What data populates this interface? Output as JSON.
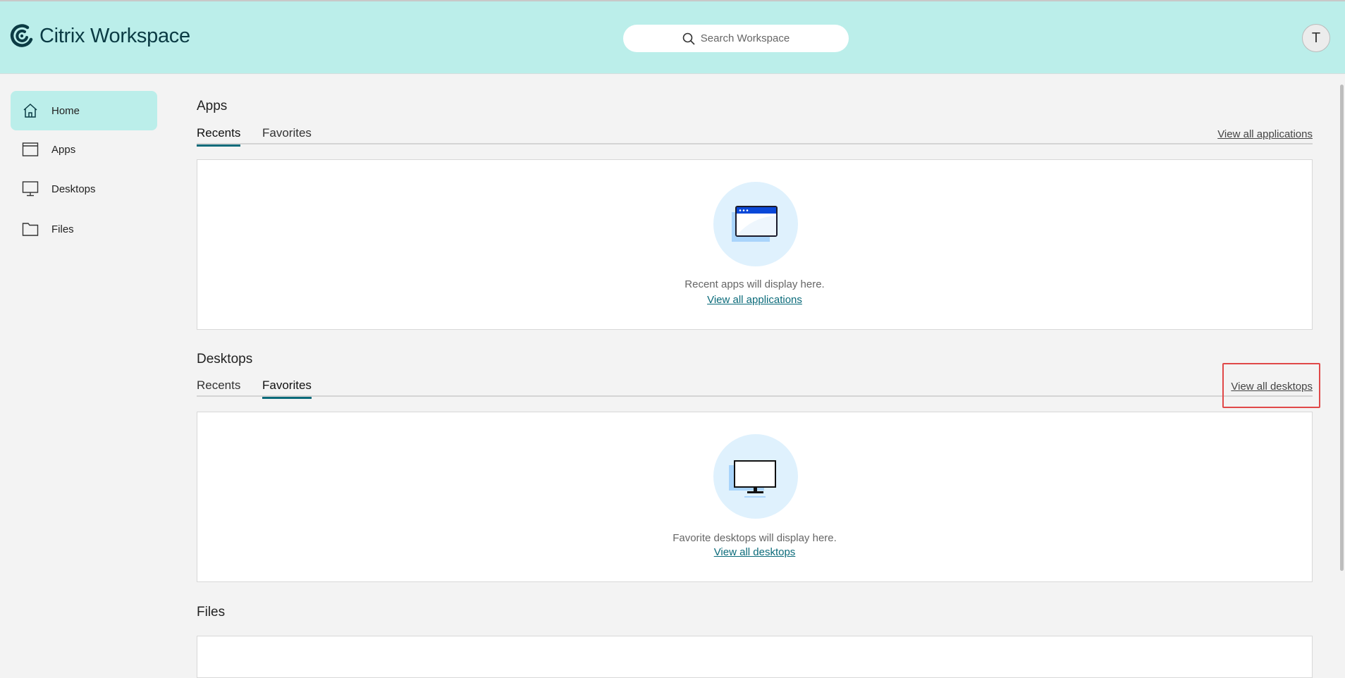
{
  "header": {
    "logo_text": "Citrix Workspace",
    "search_placeholder": "Search Workspace",
    "avatar_initial": "T"
  },
  "sidebar": {
    "items": [
      {
        "label": "Home",
        "icon": "home-icon",
        "active": true
      },
      {
        "label": "Apps",
        "icon": "app-window-icon"
      },
      {
        "label": "Desktops",
        "icon": "monitor-icon"
      },
      {
        "label": "Files",
        "icon": "folder-icon"
      }
    ]
  },
  "apps": {
    "title": "Apps",
    "tabs": [
      "Recents",
      "Favorites"
    ],
    "active_tab": "Recents",
    "view_all": "View all applications",
    "empty_text": "Recent apps will display here.",
    "empty_link": "View all applications"
  },
  "desktops": {
    "title": "Desktops",
    "tabs": [
      "Recents",
      "Favorites"
    ],
    "active_tab": "Favorites",
    "view_all": "View all desktops",
    "empty_text": "Favorite desktops will display here.",
    "empty_link": "View all desktops"
  },
  "files": {
    "title": "Files"
  },
  "colors": {
    "header_bg": "#bbeeea",
    "accent": "#0b6b7a",
    "highlight": "#e04848"
  }
}
